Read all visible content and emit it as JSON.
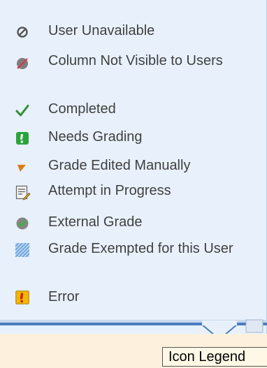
{
  "legend": {
    "items": [
      {
        "icon": "user-unavailable-icon",
        "label": "User Unavailable"
      },
      {
        "icon": "column-not-visible-icon",
        "label": "Column Not Visible to Users"
      },
      {
        "icon": "checkmark-icon",
        "label": "Completed"
      },
      {
        "icon": "needs-grading-icon",
        "label": "Needs Grading"
      },
      {
        "icon": "grade-edited-icon",
        "label": "Grade Edited Manually"
      },
      {
        "icon": "attempt-in-progress-icon",
        "label": "Attempt in Progress"
      },
      {
        "icon": "external-grade-icon",
        "label": "External Grade"
      },
      {
        "icon": "grade-exempted-icon",
        "label": "Grade Exempted for this User"
      },
      {
        "icon": "error-icon",
        "label": "Error"
      }
    ]
  },
  "tooltip": {
    "label": "Icon Legend"
  },
  "colors": {
    "panel_bg": "#e8f1fb",
    "panel_border": "#4b7dbf",
    "text": "#404040",
    "check_green": "#2f8f33",
    "badge_green": "#2ba33b",
    "edited_orange": "#e07a16",
    "error_yellow": "#f2b800",
    "error_red": "#cc1a1a",
    "lower_bg": "#fdf1dd"
  }
}
